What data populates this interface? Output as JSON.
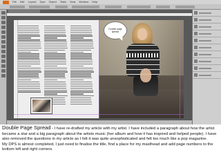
{
  "app": {
    "menu": [
      "File",
      "Edit",
      "Layout",
      "Type",
      "Object",
      "Table",
      "View",
      "Window",
      "Help"
    ]
  },
  "spread": {
    "speech_bubble_text": "Double page spread"
  },
  "caption": {
    "title": "Double Page Spread",
    "separator": " - ",
    "body_1": "I have re-drafted my article with my artist. I have included a paragraph about how the artist became a star and a big paragraph about the artists music (her album and how it has inspired and helped people). I have also removed the questions in my article as I felt it was quite unsophisticated and felt too much like a pop magazine.",
    "body_2": "My DPS is almost completed, I just need to finalise the title, find a place for my masthead and add page numbers to the bottom left and right corners."
  }
}
